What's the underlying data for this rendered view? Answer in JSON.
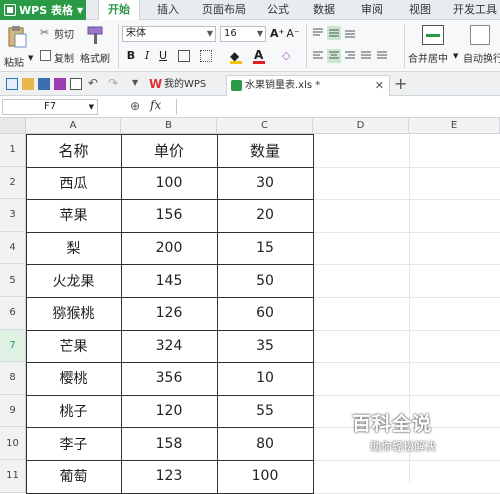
{
  "app": {
    "name": "WPS 表格"
  },
  "menu_tabs": [
    "开始",
    "插入",
    "页面布局",
    "公式",
    "数据",
    "审阅",
    "视图",
    "开发工具"
  ],
  "ribbon": {
    "paste": "粘贴",
    "cut": "剪切",
    "copy": "复制",
    "format_painter": "格式刷",
    "font_name": "宋体",
    "font_size": "16",
    "merge_center": "合并居中",
    "autowrap": "自动换行"
  },
  "doc_tabs": [
    {
      "label": "我的WPS",
      "active": false
    },
    {
      "label": "水果销量表.xls *",
      "active": true
    }
  ],
  "formula_bar": {
    "name_box": "F7",
    "fx_label": "fx",
    "content": ""
  },
  "columns": [
    "A",
    "B",
    "C",
    "D",
    "E"
  ],
  "rows": [
    "1",
    "2",
    "3",
    "4",
    "5",
    "6",
    "7",
    "8",
    "9",
    "10",
    "11"
  ],
  "selected_row": "7",
  "table": {
    "headers": [
      "名称",
      "单价",
      "数量"
    ],
    "rows": [
      [
        "西瓜",
        "100",
        "30"
      ],
      [
        "苹果",
        "156",
        "20"
      ],
      [
        "梨",
        "200",
        "15"
      ],
      [
        "火龙果",
        "145",
        "50"
      ],
      [
        "猕猴桃",
        "126",
        "60"
      ],
      [
        "芒果",
        "324",
        "35"
      ],
      [
        "樱桃",
        "356",
        "10"
      ],
      [
        "桃子",
        "120",
        "55"
      ],
      [
        "李子",
        "158",
        "80"
      ],
      [
        "葡萄",
        "123",
        "100"
      ]
    ]
  },
  "watermark": {
    "title": "百科全说",
    "subtitle": "助你轻松解决"
  },
  "colors": {
    "accent": "#2a9a46"
  }
}
